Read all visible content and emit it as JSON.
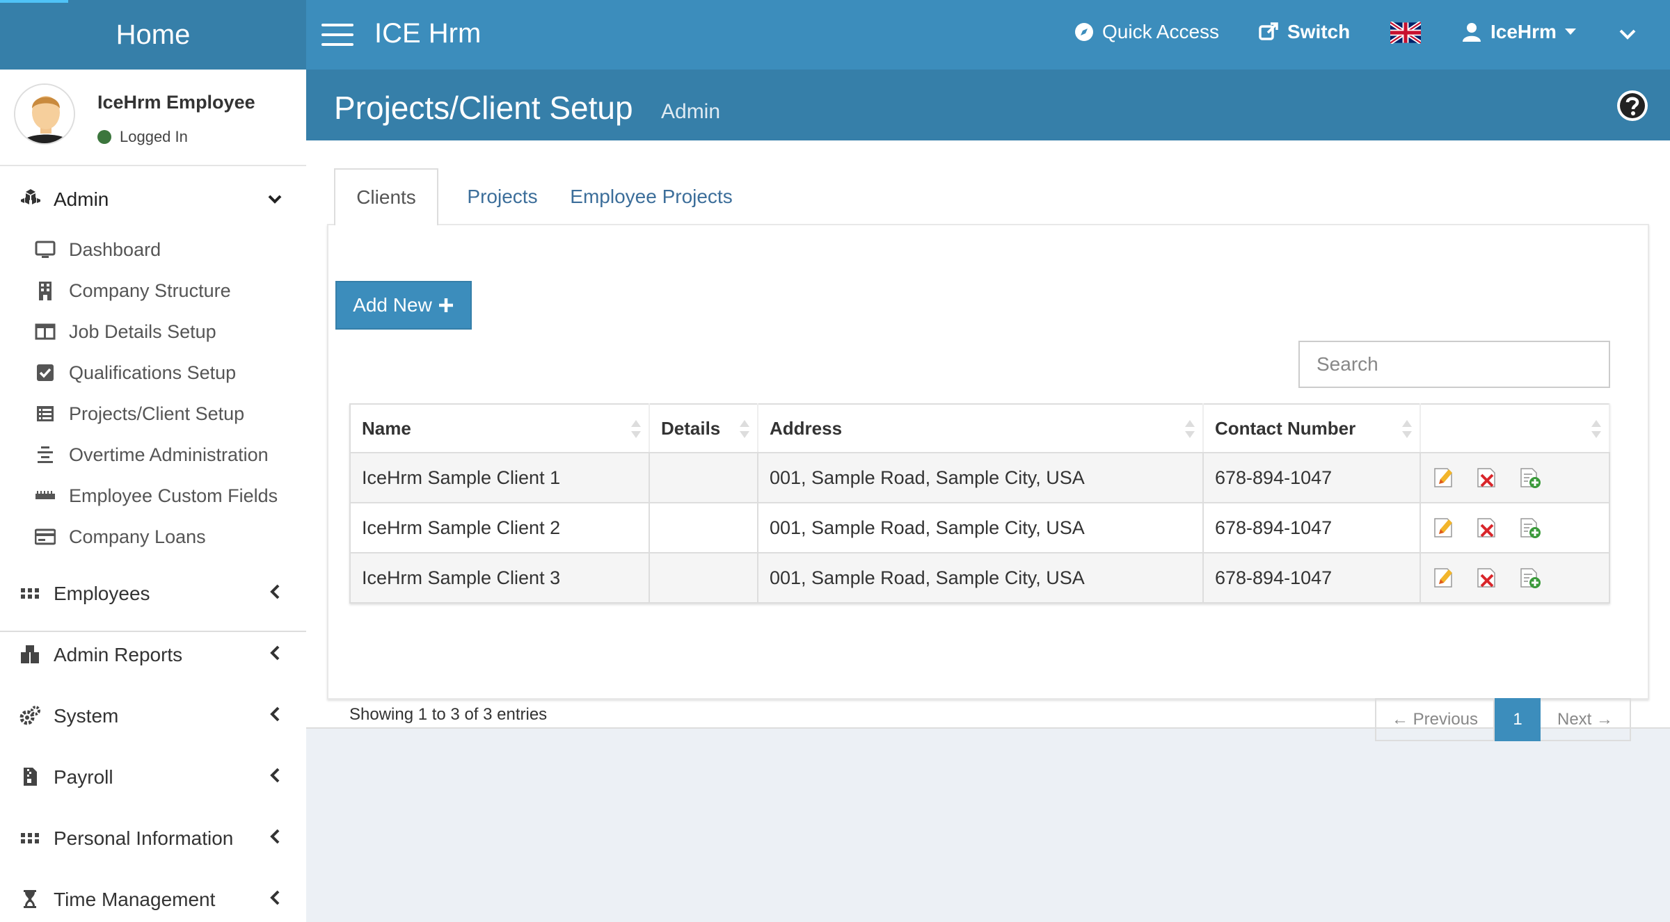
{
  "header": {
    "logo": "Home",
    "app_name": "ICE Hrm",
    "quick_access": "Quick Access",
    "switch": "Switch",
    "user": "IceHrm",
    "colors": {
      "primary": "#3c8dbc",
      "dark": "#367fa9"
    }
  },
  "sidebar": {
    "user_name": "IceHrm Employee",
    "user_status": "Logged In",
    "admin_label": "Admin",
    "admin_items": [
      {
        "label": "Dashboard",
        "icon": "monitor-icon"
      },
      {
        "label": "Company Structure",
        "icon": "building-icon"
      },
      {
        "label": "Job Details Setup",
        "icon": "columns-icon"
      },
      {
        "label": "Qualifications Setup",
        "icon": "checkbox-icon"
      },
      {
        "label": "Projects/Client Setup",
        "icon": "list-icon"
      },
      {
        "label": "Overtime Administration",
        "icon": "align-center-icon"
      },
      {
        "label": "Employee Custom Fields",
        "icon": "ruler-icon"
      },
      {
        "label": "Company Loans",
        "icon": "credit-card-icon"
      }
    ],
    "menus": [
      {
        "label": "Employees",
        "icon": "grid-icon"
      },
      {
        "label": "Admin Reports",
        "icon": "cubes-icon"
      },
      {
        "label": "System",
        "icon": "gears-icon"
      },
      {
        "label": "Payroll",
        "icon": "zip-file-icon"
      },
      {
        "label": "Personal Information",
        "icon": "grid-icon"
      },
      {
        "label": "Time Management",
        "icon": "hourglass-icon"
      }
    ]
  },
  "page": {
    "title": "Projects/Client Setup",
    "subtitle": "Admin"
  },
  "tabs": [
    "Clients",
    "Projects",
    "Employee Projects"
  ],
  "toolbar": {
    "add_new": "Add New",
    "search_placeholder": "Search"
  },
  "table": {
    "columns": [
      "Name",
      "Details",
      "Address",
      "Contact Number",
      ""
    ],
    "rows": [
      {
        "name": "IceHrm Sample Client 1",
        "details": "",
        "address": "001, Sample Road, Sample City, USA",
        "contact": "678-894-1047"
      },
      {
        "name": "IceHrm Sample Client 2",
        "details": "",
        "address": "001, Sample Road, Sample City, USA",
        "contact": "678-894-1047"
      },
      {
        "name": "IceHrm Sample Client 3",
        "details": "",
        "address": "001, Sample Road, Sample City, USA",
        "contact": "678-894-1047"
      }
    ]
  },
  "pagination": {
    "info": "Showing 1 to 3 of 3 entries",
    "previous": "← Previous",
    "page": "1",
    "next": "Next →"
  }
}
